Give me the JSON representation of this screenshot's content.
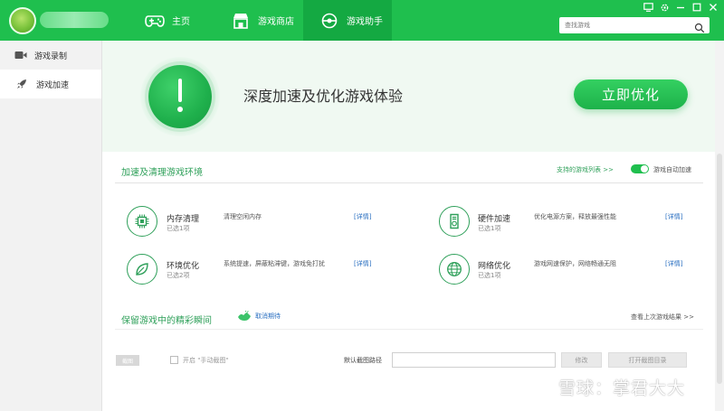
{
  "colors": {
    "brand_green": "#1fbf4e",
    "active_tab": "#14a942",
    "link_blue": "#2a6fc1",
    "section_green": "#2fa05a"
  },
  "nav": {
    "tabs": [
      {
        "label": "主页",
        "icon": "gamepad-icon"
      },
      {
        "label": "游戏商店",
        "icon": "store-icon"
      },
      {
        "label": "游戏助手",
        "icon": "helper-icon",
        "active": true
      }
    ]
  },
  "window_controls": [
    "message-icon",
    "settings-icon",
    "minimize-icon",
    "maximize-icon",
    "close-icon"
  ],
  "search": {
    "placeholder": "查找游戏",
    "icon": "search-icon"
  },
  "sidebar": {
    "items": [
      {
        "label": "游戏录制",
        "icon": "video-camera-icon"
      },
      {
        "label": "游戏加速",
        "icon": "rocket-icon",
        "active": true
      }
    ]
  },
  "hero": {
    "title": "深度加速及优化游戏体验",
    "button": "立即优化",
    "icon": "exclamation-icon"
  },
  "accel": {
    "title": "加速及清理游戏环境",
    "support_link": "支持的游戏列表 >>",
    "auto_label": "游戏自动加速",
    "auto_on": true,
    "features": [
      {
        "name": "内存清理",
        "sub": "已选1项",
        "desc": "清理空闲内存",
        "detail": "[详情]",
        "icon": "chip-icon"
      },
      {
        "name": "硬件加速",
        "sub": "已选1项",
        "desc": "优化电源方案，释放最强性能",
        "detail": "[详情]",
        "icon": "hardware-icon"
      },
      {
        "name": "环境优化",
        "sub": "已选2项",
        "desc": "系统提速，屏蔽粘滞键，游戏免打扰",
        "detail": "[详情]",
        "icon": "leaf-icon"
      },
      {
        "name": "网络优化",
        "sub": "已选1项",
        "desc": "游戏网速保护，网络畅通无阻",
        "detail": "[详情]",
        "icon": "globe-icon"
      }
    ]
  },
  "moments": {
    "title": "保留游戏中的精彩瞬间",
    "cancel_label": "取消期待",
    "view_last": "查看上次游戏结果 >>",
    "screenshot_tag": "截图",
    "checkbox_label": "开启 \"手动截图\"",
    "path_label": "默认截图路径",
    "path_value": "",
    "modify_button": "修改",
    "open_button": "打开截图目录"
  },
  "watermark": {
    "text": "雪球：掌君大大"
  }
}
